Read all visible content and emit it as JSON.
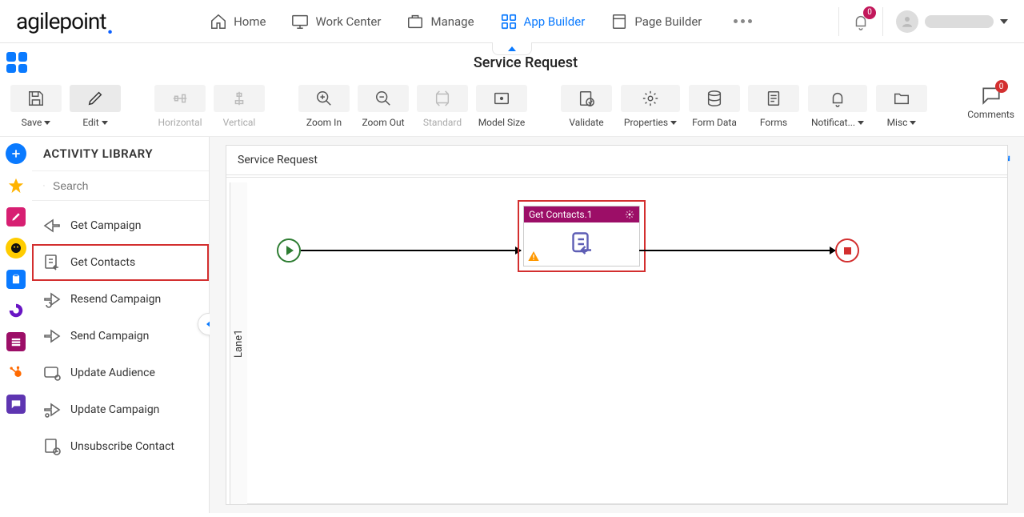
{
  "brand": "agilepoint",
  "nav": {
    "home": "Home",
    "work_center": "Work Center",
    "manage": "Manage",
    "app_builder": "App Builder",
    "page_builder": "Page Builder"
  },
  "notifications_count": "0",
  "page_title": "Service Request",
  "toolbar": {
    "save": "Save",
    "edit": "Edit",
    "horizontal": "Horizontal",
    "vertical": "Vertical",
    "zoom_in": "Zoom In",
    "zoom_out": "Zoom Out",
    "standard": "Standard",
    "model_size": "Model Size",
    "validate": "Validate",
    "properties": "Properties",
    "form_data": "Form Data",
    "forms": "Forms",
    "notifications": "Notificat...",
    "misc": "Misc",
    "comments": "Comments",
    "comments_count": "0"
  },
  "sidebar": {
    "title": "ACTIVITY LIBRARY",
    "search_placeholder": "Search",
    "items": [
      "Get Campaign",
      "Get Contacts",
      "Resend Campaign",
      "Send Campaign",
      "Update Audience",
      "Update Campaign",
      "Unsubscribe Contact"
    ]
  },
  "canvas": {
    "title": "Service Request",
    "lane": "Lane1",
    "node_title": "Get Contacts.1"
  }
}
